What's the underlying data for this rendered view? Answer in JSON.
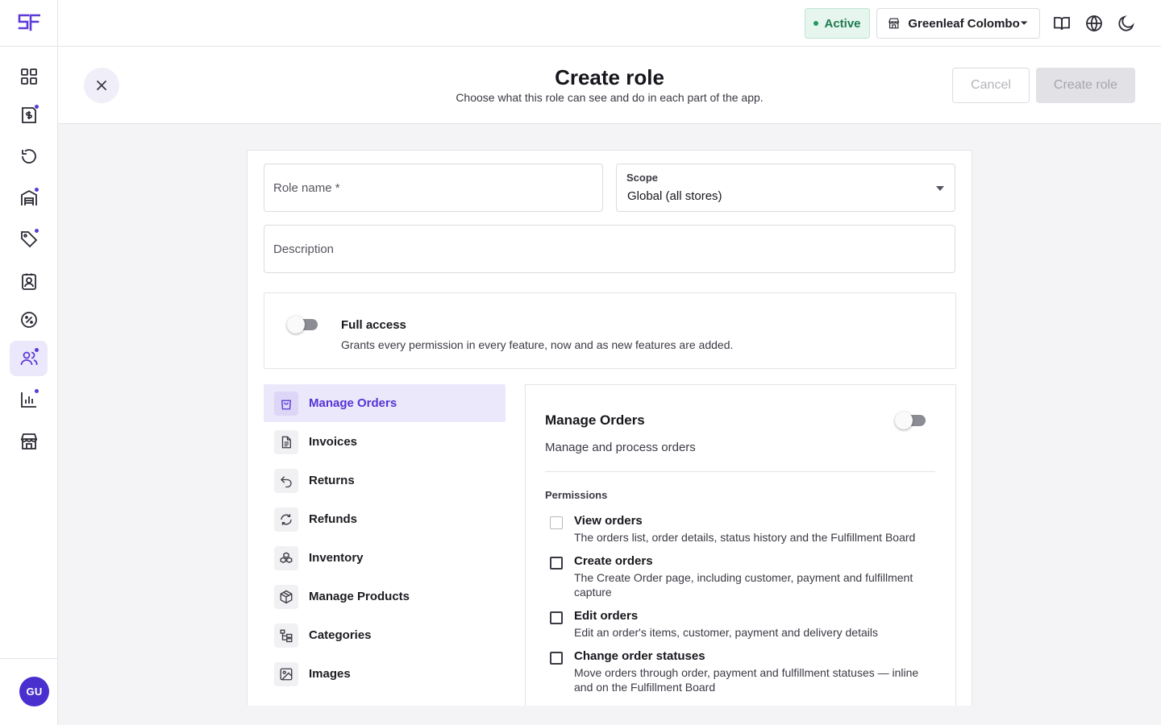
{
  "brand": {
    "logo_text": "SF",
    "accent": "#5b3ad8"
  },
  "rail": {
    "items": [
      {
        "name": "dashboard-icon",
        "dot": false,
        "active": false
      },
      {
        "name": "invoice-dollar-icon",
        "dot": true,
        "active": false
      },
      {
        "name": "history-icon",
        "dot": false,
        "active": false
      },
      {
        "name": "warehouse-icon",
        "dot": true,
        "active": false
      },
      {
        "name": "tag-icon",
        "dot": true,
        "active": false
      },
      {
        "name": "contacts-icon",
        "dot": false,
        "active": false
      },
      {
        "name": "discount-icon",
        "dot": false,
        "active": false
      },
      {
        "name": "users-icon",
        "dot": true,
        "active": true
      },
      {
        "name": "analytics-icon",
        "dot": true,
        "active": false
      },
      {
        "name": "store-icon",
        "dot": false,
        "active": false
      }
    ],
    "avatar_initials": "GU"
  },
  "topbar": {
    "status": "Active",
    "store": "Greenleaf Colombo",
    "icons": [
      "book-icon",
      "globe-icon",
      "moon-icon"
    ]
  },
  "header": {
    "title": "Create role",
    "subtitle": "Choose what this role can see and do in each part of the app.",
    "cancel_label": "Cancel",
    "create_label": "Create role"
  },
  "form": {
    "role_name_placeholder": "Role name *",
    "scope_label": "Scope",
    "scope_value": "Global (all stores)",
    "description_placeholder": "Description"
  },
  "full_access": {
    "title": "Full access",
    "description": "Grants every permission in every feature, now and as new features are added.",
    "enabled": false
  },
  "features": [
    {
      "label": "Manage Orders",
      "icon": "shopping-bag-icon",
      "active": true
    },
    {
      "label": "Invoices",
      "icon": "document-icon",
      "active": false
    },
    {
      "label": "Returns",
      "icon": "undo-icon",
      "active": false
    },
    {
      "label": "Refunds",
      "icon": "refresh-icon",
      "active": false
    },
    {
      "label": "Inventory",
      "icon": "boxes-icon",
      "active": false
    },
    {
      "label": "Manage Products",
      "icon": "package-icon",
      "active": false
    },
    {
      "label": "Categories",
      "icon": "tree-icon",
      "active": false
    },
    {
      "label": "Images",
      "icon": "image-icon",
      "active": false
    }
  ],
  "detail": {
    "title": "Manage Orders",
    "description": "Manage and process orders",
    "enabled": false,
    "permissions_heading": "Permissions",
    "permissions": [
      {
        "title": "View orders",
        "description": "The orders list, order details, status history and the Fulfillment Board",
        "checked": false
      },
      {
        "title": "Create orders",
        "description": "The Create Order page, including customer, payment and fulfillment capture",
        "checked": false
      },
      {
        "title": "Edit orders",
        "description": "Edit an order's items, customer, payment and delivery details",
        "checked": false
      },
      {
        "title": "Change order statuses",
        "description": "Move orders through order, payment and fulfillment statuses — inline and on the Fulfillment Board",
        "checked": false
      }
    ]
  }
}
